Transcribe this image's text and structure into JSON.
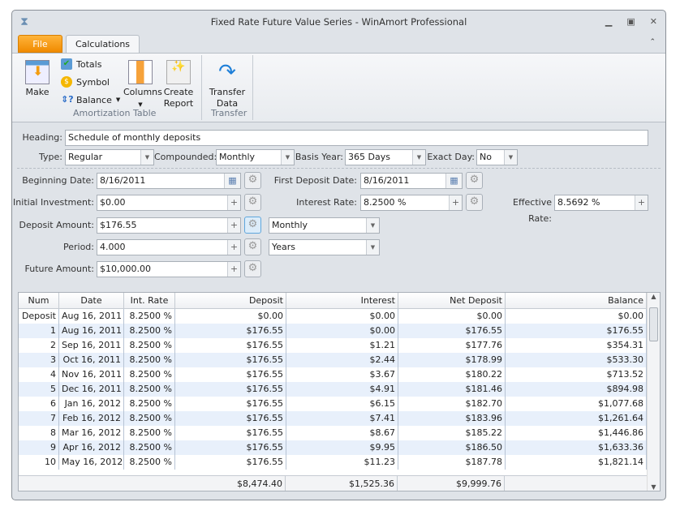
{
  "window": {
    "title": "Fixed Rate Future Value Series - WinAmort Professional"
  },
  "tabs": {
    "file": "File",
    "calculations": "Calculations"
  },
  "ribbon": {
    "make": "Make",
    "totals": "Totals",
    "symbol": "Symbol",
    "balance": "Balance",
    "columns": "Columns",
    "create": "Create",
    "report": "Report",
    "transfer": "Transfer",
    "data": "Data",
    "group_amort": "Amortization Table",
    "group_transfer": "Transfer"
  },
  "form": {
    "heading_label": "Heading:",
    "heading": "Schedule of monthly deposits",
    "type_label": "Type:",
    "type": "Regular",
    "compounded_label": "Compounded:",
    "compounded": "Monthly",
    "basis_label": "Basis Year:",
    "basis": "365 Days",
    "exact_label": "Exact Day:",
    "exact": "No",
    "begin_label": "Beginning Date:",
    "begin": "8/16/2011",
    "first_label": "First Deposit Date:",
    "first": "8/16/2011",
    "initial_label": "Initial Investment:",
    "initial": "$0.00",
    "rate_label": "Interest Rate:",
    "rate": "8.2500 %",
    "eff_label": "Effective Rate:",
    "eff": "8.5692 %",
    "deposit_label": "Deposit Amount:",
    "deposit": "$176.55",
    "deposit_freq": "Monthly",
    "period_label": "Period:",
    "period": "4.000",
    "period_unit": "Years",
    "future_label": "Future Amount:",
    "future": "$10,000.00"
  },
  "table": {
    "columns": [
      "Num",
      "Date",
      "Int. Rate",
      "Deposit",
      "Interest",
      "Net Deposit",
      "Balance"
    ],
    "rows": [
      [
        "Deposit",
        "Aug 16, 2011",
        "8.2500 %",
        "$0.00",
        "$0.00",
        "$0.00",
        "$0.00"
      ],
      [
        "1",
        "Aug 16, 2011",
        "8.2500 %",
        "$176.55",
        "$0.00",
        "$176.55",
        "$176.55"
      ],
      [
        "2",
        "Sep 16, 2011",
        "8.2500 %",
        "$176.55",
        "$1.21",
        "$177.76",
        "$354.31"
      ],
      [
        "3",
        "Oct 16, 2011",
        "8.2500 %",
        "$176.55",
        "$2.44",
        "$178.99",
        "$533.30"
      ],
      [
        "4",
        "Nov 16, 2011",
        "8.2500 %",
        "$176.55",
        "$3.67",
        "$180.22",
        "$713.52"
      ],
      [
        "5",
        "Dec 16, 2011",
        "8.2500 %",
        "$176.55",
        "$4.91",
        "$181.46",
        "$894.98"
      ],
      [
        "6",
        "Jan 16, 2012",
        "8.2500 %",
        "$176.55",
        "$6.15",
        "$182.70",
        "$1,077.68"
      ],
      [
        "7",
        "Feb 16, 2012",
        "8.2500 %",
        "$176.55",
        "$7.41",
        "$183.96",
        "$1,261.64"
      ],
      [
        "8",
        "Mar 16, 2012",
        "8.2500 %",
        "$176.55",
        "$8.67",
        "$185.22",
        "$1,446.86"
      ],
      [
        "9",
        "Apr 16, 2012",
        "8.2500 %",
        "$176.55",
        "$9.95",
        "$186.50",
        "$1,633.36"
      ],
      [
        "10",
        "May 16, 2012",
        "8.2500 %",
        "$176.55",
        "$11.23",
        "$187.78",
        "$1,821.14"
      ]
    ],
    "totals": {
      "deposit": "$8,474.40",
      "interest": "$1,525.36",
      "net": "$9,999.76"
    }
  }
}
